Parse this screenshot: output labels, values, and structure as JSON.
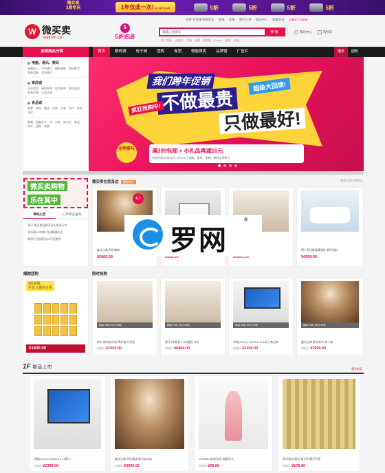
{
  "top_banner": {
    "logo_line1": "微买卖",
    "logo_line2": "3周年庆",
    "slogan": "1年仅此一次!",
    "slogan_dates": "11.18~11.26",
    "deal_label": "5折"
  },
  "util_bar": [
    "您好,欢迎来到微买卖",
    "登录",
    "注册",
    "我的订单",
    "帮助中心",
    "收藏本站",
    "13907773298"
  ],
  "header": {
    "logo_mark": "W",
    "logo_text": "微买卖",
    "logo_url": "weimm.cn",
    "promo_num": "5",
    "promo_text": "5折名品",
    "search_placeholder": "请输入关键词",
    "search_button": "搜 索",
    "hot_words": [
      "热门搜索:",
      "电视柜",
      "空调",
      "电视",
      "组合柜",
      "iPhone",
      "窗帘",
      "沙发"
    ],
    "my_account": "我的中心",
    "cart": "购物车"
  },
  "nav": {
    "category_label": "全部商品分类",
    "items": [
      "首页",
      "数码城",
      "电子城",
      "团购",
      "促销",
      "微能微卖",
      "品牌馆",
      "广告栏"
    ],
    "right_items": [
      "晒单",
      "团购"
    ]
  },
  "categories": [
    {
      "title": "电脑、通讯、数码",
      "subs": [
        "电脑办公",
        "手机通讯",
        "摄影摄像",
        "数码影音",
        "智能设备",
        "家电周边"
      ]
    },
    {
      "title": "家居城",
      "subs": [
        "沐浴用品",
        "厨房家电",
        "生活家电",
        "家纺床品",
        "家具家装",
        "卫浴洁具"
      ]
    },
    {
      "title": "食品城",
      "subs": [
        "零食",
        "饮料",
        "粮油",
        "生鲜",
        "水果",
        "特产",
        "茶叶",
        "冲饮"
      ]
    },
    {
      "title": "热卖",
      "subs": [
        "电脑办公",
        "床",
        "沙发",
        "床头柜",
        "新品",
        "特价",
        "团购",
        "优惠"
      ]
    }
  ],
  "hero": {
    "line1": "我们跨年促销",
    "ribbon": "超级大回馈!",
    "line2": "不做最贵",
    "line3": "只做最好!",
    "crazy": "疯狂抢购中!",
    "circle": "全场参与",
    "note_main": "满399包邮 + 小礼品再减10元",
    "note_sub": "活动时间:12月01日-12月31日 电脑、家电、家具、数码全场参与"
  },
  "section1": {
    "promo_line1": "微买卖购物",
    "promo_line2": "乐在其中",
    "tabs": [
      "网站公告",
      "订单状态查询"
    ],
    "news": [
      "双12 微买卖促销活动火热进行中",
      "全场满399包邮 再送精美礼品",
      "新用户注册即送20元优惠券"
    ],
    "title": "微买卖在您身边",
    "tag": "搜索附近",
    "location": "查看全国店铺地址",
    "badge": "6.7",
    "products": [
      {
        "name": "美式古典 四柱婚床",
        "price": "¥2660.00"
      },
      {
        "name": "LED吸顶灯 卧室灯",
        "price": "¥168.00"
      },
      {
        "name": "欧式卧室 公主床",
        "price": "¥3680.00"
      },
      {
        "name": "四人多功能按摩浴缸 豪华浴缸",
        "price": "¥4999.00"
      }
    ]
  },
  "section2": {
    "left_title": "爆款团购",
    "mid_title": "限时抢购",
    "tuan_badge_line1": "5折特惠",
    "tuan_badge_line2": "可爱儿童组合柜",
    "tuan_price": "¥1800.00",
    "items": [
      {
        "countdown": "剩余 23时 59分 59秒",
        "name": "特价 欧式床头柜 简约现代 卧室",
        "old_price": "抢购价:",
        "price": "¥1500.00"
      },
      {
        "countdown": "剩余 23时 59分 59秒",
        "name": "餐厅5件套装 1.5米圆台 实木",
        "old_price": "抢购价:",
        "price": "¥6800.00"
      },
      {
        "countdown": "剩余 23时 59分 59秒",
        "name": "华硕(ASUS) X552EA 15.6英寸笔记本",
        "old_price": "抢购价:",
        "price": "¥2399.00"
      },
      {
        "countdown": "剩余 23时 59分 59秒",
        "name": "美式古典 欧式实木 双人床",
        "old_price": "抢购价:",
        "price": "¥3999.00"
      }
    ]
  },
  "section3": {
    "floor": "1F",
    "title": "新品上市",
    "more": "更多新品",
    "items": [
      {
        "name": "华硕(ASUS) X552EA 15.6英寸...",
        "old_price": "市场价:",
        "price": "¥2399.00"
      },
      {
        "name": "美式古典 四柱婚床 欧式实木床",
        "old_price": "市场价:",
        "price": "¥3999.00"
      },
      {
        "name": "DFMOBA女装浴袍 纯棉浴巾...",
        "old_price": "市场价:",
        "price": "¥28.00"
      },
      {
        "name": "欧式高档 窗帘 遮光布 客厅卧室",
        "old_price": "市场价:",
        "price": "¥178.00"
      }
    ]
  },
  "watermark": {
    "text": "罗网",
    "mark": "®"
  }
}
